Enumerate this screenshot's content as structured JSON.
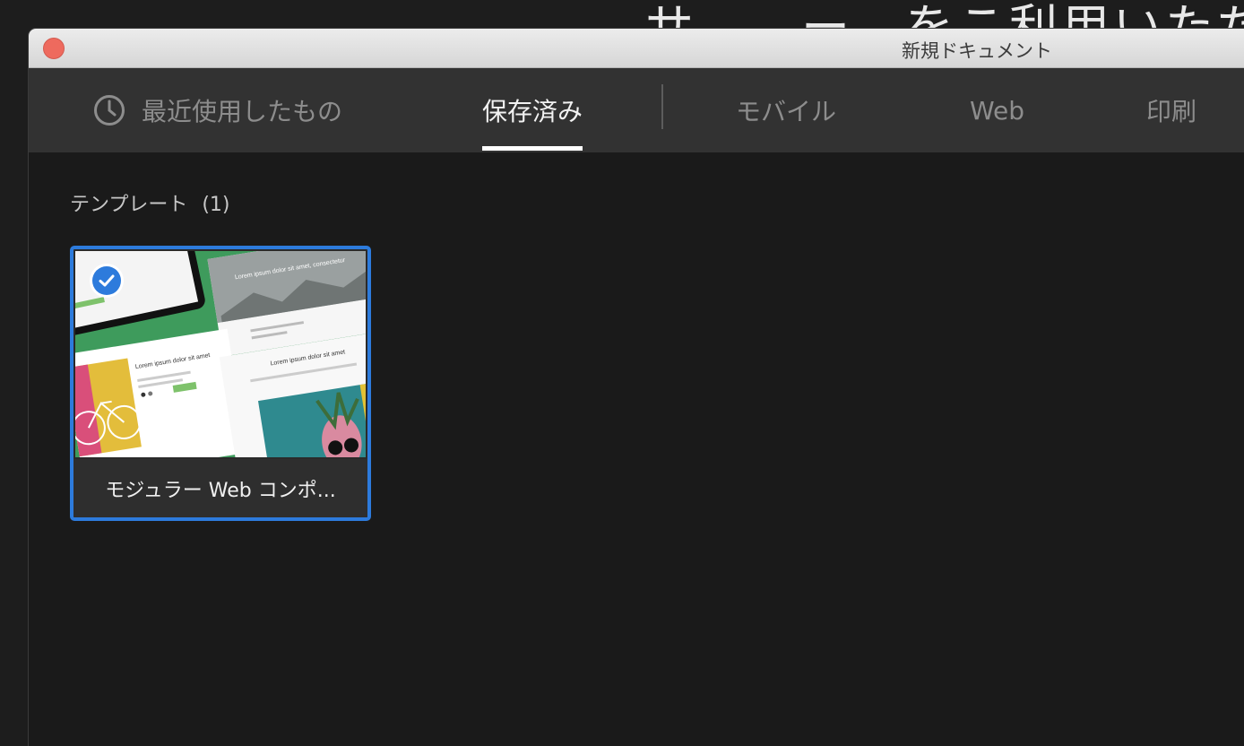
{
  "background": {
    "partial_text": "サ　　ー　をこ利用いただ"
  },
  "window": {
    "title": "新規ドキュメント"
  },
  "tabs": [
    {
      "label": "最近使用したもの",
      "icon": "clock-icon"
    },
    {
      "label": "保存済み",
      "active": true
    },
    {
      "label": "モバイル"
    },
    {
      "label": "Web"
    },
    {
      "label": "印刷"
    }
  ],
  "section": {
    "heading": "テンプレート",
    "count": "(1)"
  },
  "templates": [
    {
      "label": "モジュラー Web コンポ...",
      "selected": true,
      "thumbnail": {
        "headline_left": "Lorem ipsum dolor sit amet",
        "headline_right": "Lorem ipsum dolor sit amet",
        "headline_top": "Lorem ipsum dolor sit amet, consectetur"
      }
    }
  ],
  "colors": {
    "accent": "#2d7bdc",
    "tab_bar": "#323232",
    "content_bg": "#1a1a1a",
    "close_button": "#ee6a5e"
  }
}
